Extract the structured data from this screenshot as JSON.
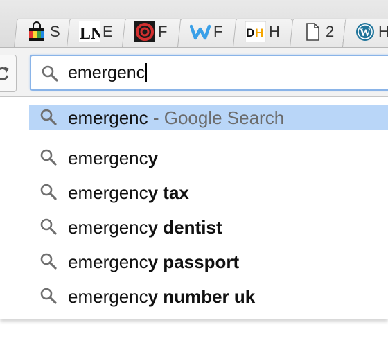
{
  "tabs": [
    {
      "icon": "shopping-bag-icon",
      "title": "S"
    },
    {
      "icon": "ln-logo-icon",
      "title": "E"
    },
    {
      "icon": "red-swirl-icon",
      "title": "F"
    },
    {
      "icon": "w-logo-icon",
      "title": "F"
    },
    {
      "icon": "dh-logo-icon",
      "title": "H"
    },
    {
      "icon": "document-icon",
      "title": "2"
    },
    {
      "icon": "wordpress-icon",
      "title": "H"
    }
  ],
  "omnibox": {
    "typed": "emergenc",
    "icon": "search-icon"
  },
  "suggestions": [
    {
      "prefix": "emergenc",
      "completion": "",
      "suffix": " - Google Search",
      "selected": true
    },
    {
      "prefix": "emergenc",
      "completion": "y",
      "suffix": "",
      "selected": false
    },
    {
      "prefix": "emergenc",
      "completion": "y tax",
      "suffix": "",
      "selected": false
    },
    {
      "prefix": "emergenc",
      "completion": "y dentist",
      "suffix": "",
      "selected": false
    },
    {
      "prefix": "emergenc",
      "completion": "y passport",
      "suffix": "",
      "selected": false
    },
    {
      "prefix": "emergenc",
      "completion": "y number uk",
      "suffix": "",
      "selected": false
    }
  ],
  "colors": {
    "accent_border": "#8ab4e8",
    "selected_row": "#b9d6f8"
  }
}
